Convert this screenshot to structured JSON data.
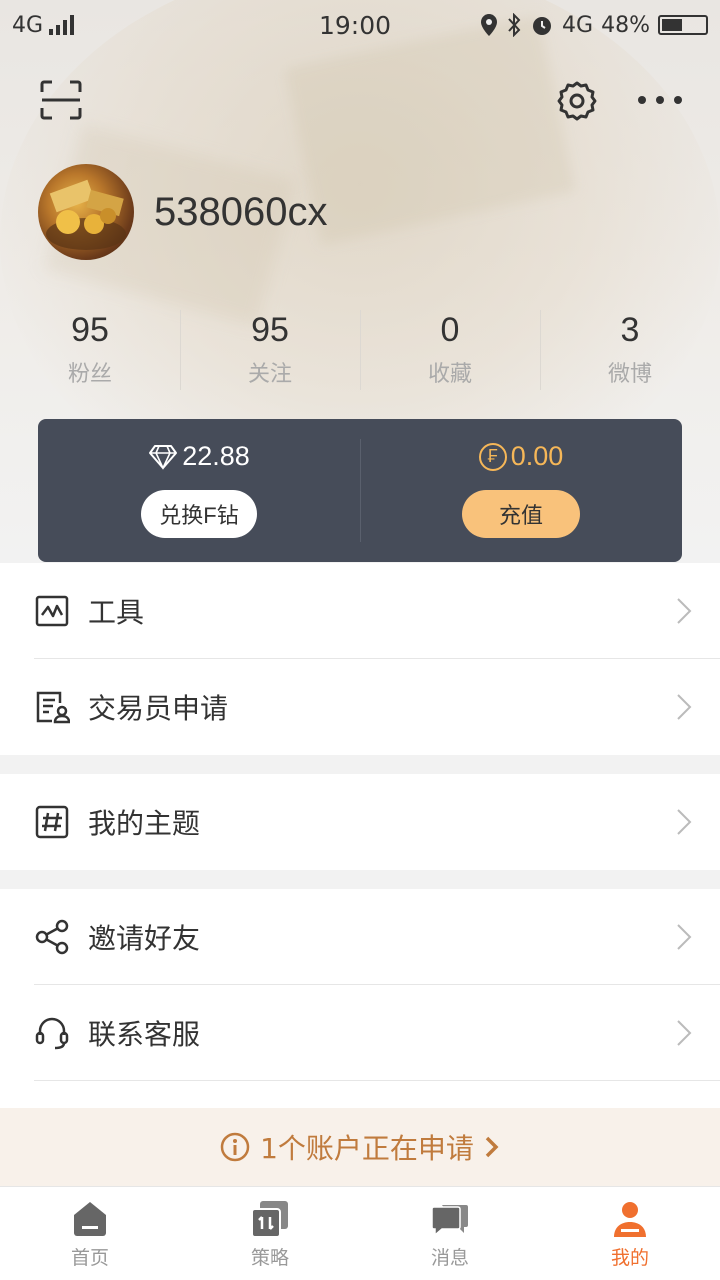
{
  "status_bar": {
    "network": "4G",
    "time": "19:00",
    "network_right": "4G",
    "battery": "48%"
  },
  "profile": {
    "username": "538060cx"
  },
  "stats": [
    {
      "value": "95",
      "label": "粉丝"
    },
    {
      "value": "95",
      "label": "关注"
    },
    {
      "value": "0",
      "label": "收藏"
    },
    {
      "value": "3",
      "label": "微博"
    }
  ],
  "wallet": {
    "diamonds": "22.88",
    "exchange_label": "兑换F钻",
    "coin_symbol": "₣",
    "coins": "0.00",
    "recharge_label": "充值"
  },
  "menu": {
    "tools": "工具",
    "trader_apply": "交易员申请",
    "my_topics": "我的主题",
    "invite": "邀请好友",
    "support": "联系客服"
  },
  "notice": {
    "text": "1个账户正在申请"
  },
  "nav": [
    {
      "label": "首页"
    },
    {
      "label": "策略"
    },
    {
      "label": "消息"
    },
    {
      "label": "我的"
    }
  ],
  "colors": {
    "accent": "#f0702f",
    "wallet_bg": "#464c59",
    "gold": "#f6b758",
    "notice": "#c07b3d"
  }
}
